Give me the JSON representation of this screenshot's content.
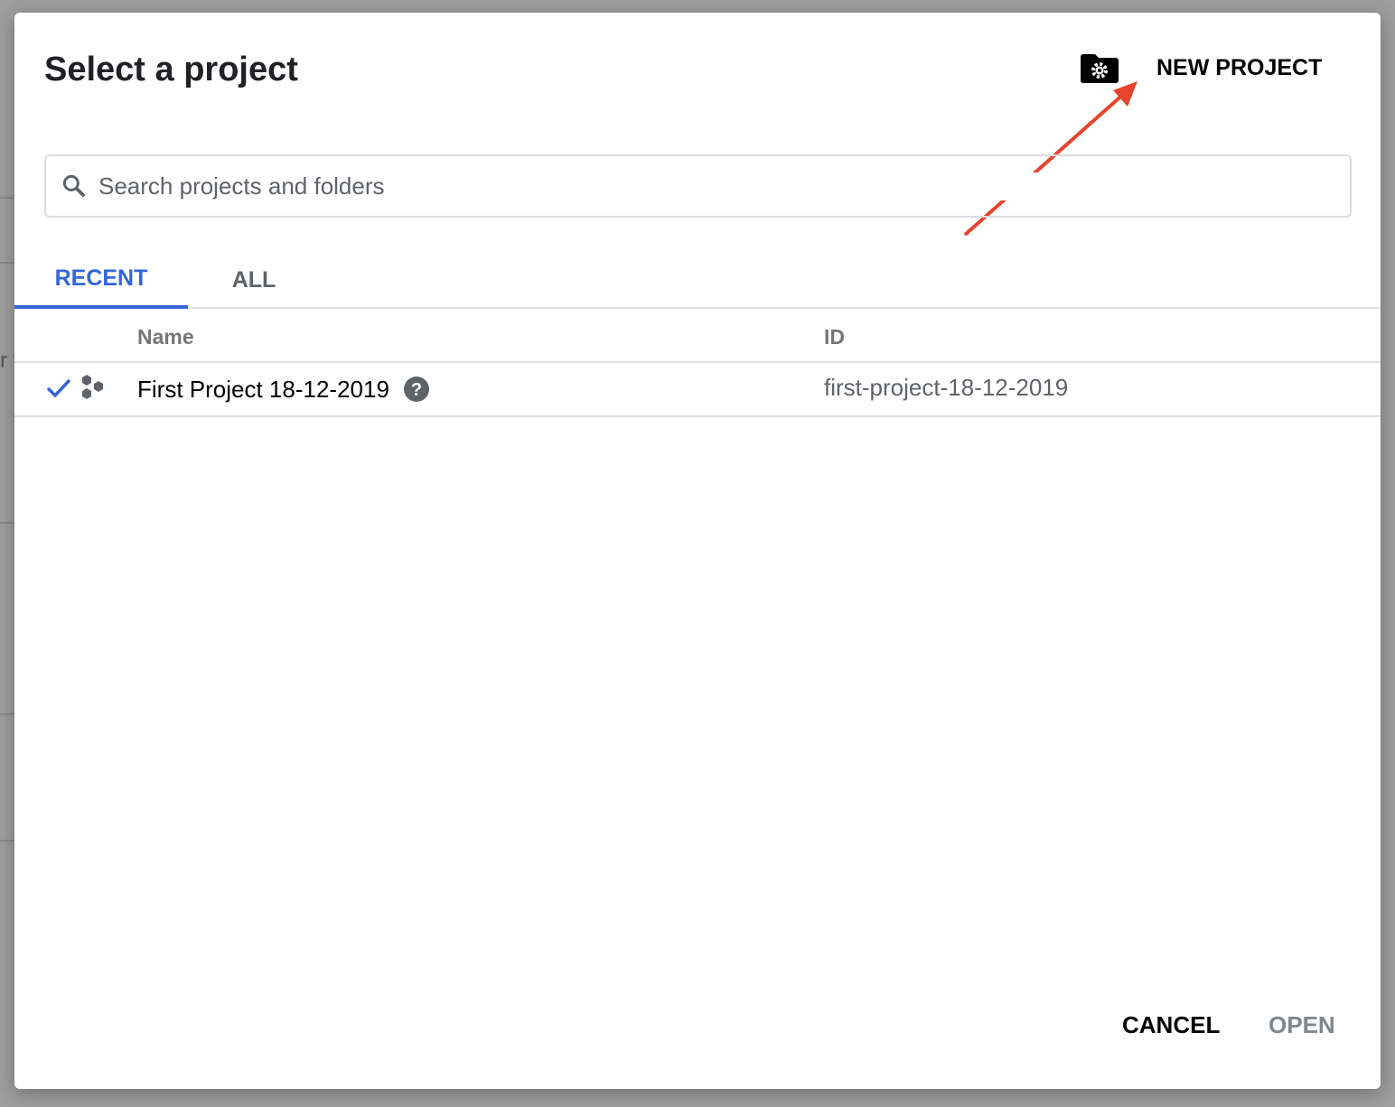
{
  "dialog": {
    "title": "Select a project",
    "new_project_label": "NEW PROJECT",
    "search": {
      "placeholder": "Search projects and folders",
      "value": ""
    },
    "tabs": [
      {
        "label": "RECENT",
        "active": true
      },
      {
        "label": "ALL",
        "active": false
      }
    ],
    "table": {
      "columns": [
        "Name",
        "ID"
      ],
      "rows": [
        {
          "name": "First Project 18-12-2019",
          "id": "first-project-18-12-2019",
          "selected": true
        }
      ]
    },
    "buttons": {
      "cancel": "CANCEL",
      "open": "OPEN"
    }
  },
  "background": {
    "partial_text": "r t"
  },
  "colors": {
    "accent": "#3367d6",
    "arrow": "#e8432d"
  }
}
